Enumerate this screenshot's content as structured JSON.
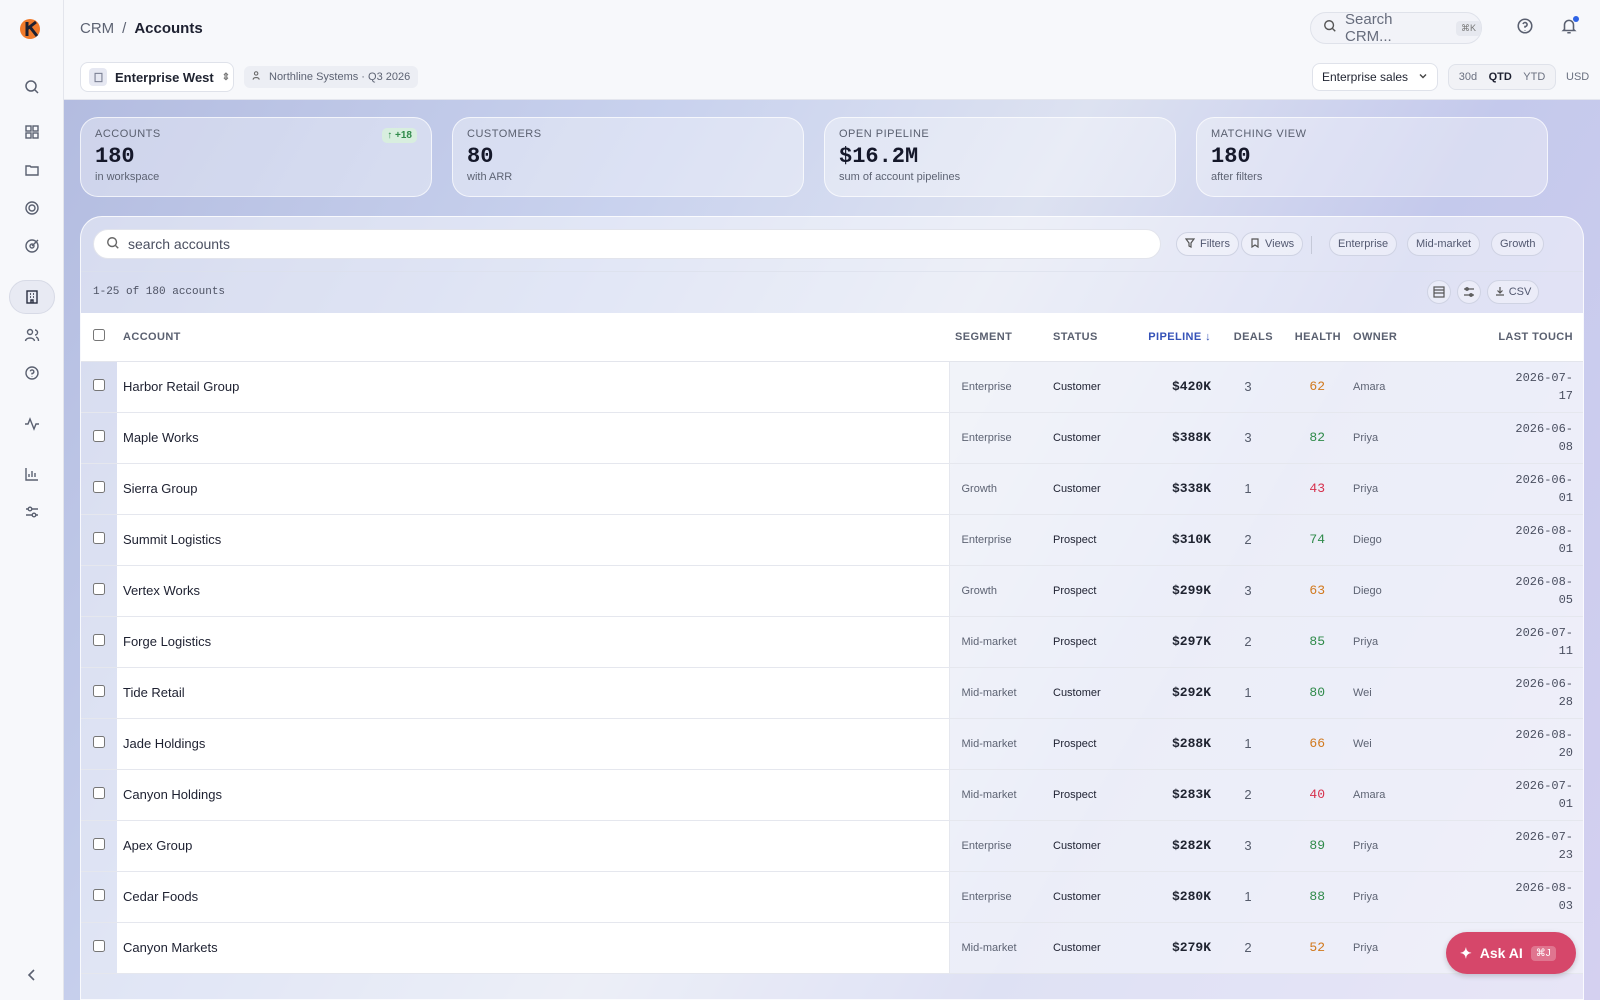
{
  "header": {
    "breadcrumb": [
      "CRM",
      "/",
      "Accounts"
    ],
    "search_placeholder": "Search CRM...",
    "search_shortcut": "⌘K"
  },
  "subbar": {
    "workspace": "Enterprise West",
    "org": "Northline Systems · Q3 2026",
    "team": "Enterprise sales",
    "periods": [
      "30d",
      "QTD",
      "YTD"
    ],
    "active_period": "QTD",
    "currency": "USD"
  },
  "stats": [
    {
      "label": "ACCOUNTS",
      "value": "180",
      "sub": "in workspace",
      "delta": "+18"
    },
    {
      "label": "CUSTOMERS",
      "value": "80",
      "sub": "with ARR"
    },
    {
      "label": "OPEN PIPELINE",
      "value": "$16.2M",
      "sub": "sum of account pipelines"
    },
    {
      "label": "MATCHING VIEW",
      "value": "180",
      "sub": "after filters"
    }
  ],
  "toolbar": {
    "search_placeholder": "search accounts",
    "filters_label": "Filters",
    "views_label": "Views",
    "segment_chips": [
      "Enterprise",
      "Mid-market",
      "Growth"
    ],
    "count_text": "1-25 of 180 accounts",
    "csv_label": "CSV"
  },
  "table": {
    "columns": [
      "ACCOUNT",
      "SEGMENT",
      "STATUS",
      "PIPELINE",
      "DEALS",
      "HEALTH",
      "OWNER",
      "LAST TOUCH"
    ],
    "rows": [
      {
        "account": "Harbor Retail Group",
        "segment": "Enterprise",
        "status": "Customer",
        "pipeline": "$420K",
        "deals": "3",
        "health": "62",
        "owner": "Amara",
        "last_touch": "2026-07-17"
      },
      {
        "account": "Maple Works",
        "segment": "Enterprise",
        "status": "Customer",
        "pipeline": "$388K",
        "deals": "3",
        "health": "82",
        "owner": "Priya",
        "last_touch": "2026-06-08"
      },
      {
        "account": "Sierra Group",
        "segment": "Growth",
        "status": "Customer",
        "pipeline": "$338K",
        "deals": "1",
        "health": "43",
        "owner": "Priya",
        "last_touch": "2026-06-01"
      },
      {
        "account": "Summit Logistics",
        "segment": "Enterprise",
        "status": "Prospect",
        "pipeline": "$310K",
        "deals": "2",
        "health": "74",
        "owner": "Diego",
        "last_touch": "2026-08-01"
      },
      {
        "account": "Vertex Works",
        "segment": "Growth",
        "status": "Prospect",
        "pipeline": "$299K",
        "deals": "3",
        "health": "63",
        "owner": "Diego",
        "last_touch": "2026-08-05"
      },
      {
        "account": "Forge Logistics",
        "segment": "Mid-market",
        "status": "Prospect",
        "pipeline": "$297K",
        "deals": "2",
        "health": "85",
        "owner": "Priya",
        "last_touch": "2026-07-11"
      },
      {
        "account": "Tide Retail",
        "segment": "Mid-market",
        "status": "Customer",
        "pipeline": "$292K",
        "deals": "1",
        "health": "80",
        "owner": "Wei",
        "last_touch": "2026-06-28"
      },
      {
        "account": "Jade Holdings",
        "segment": "Mid-market",
        "status": "Prospect",
        "pipeline": "$288K",
        "deals": "1",
        "health": "66",
        "owner": "Wei",
        "last_touch": "2026-08-20"
      },
      {
        "account": "Canyon Holdings",
        "segment": "Mid-market",
        "status": "Prospect",
        "pipeline": "$283K",
        "deals": "2",
        "health": "40",
        "owner": "Amara",
        "last_touch": "2026-07-01"
      },
      {
        "account": "Apex Group",
        "segment": "Enterprise",
        "status": "Customer",
        "pipeline": "$282K",
        "deals": "3",
        "health": "89",
        "owner": "Priya",
        "last_touch": "2026-07-23"
      },
      {
        "account": "Cedar Foods",
        "segment": "Enterprise",
        "status": "Customer",
        "pipeline": "$280K",
        "deals": "1",
        "health": "88",
        "owner": "Priya",
        "last_touch": "2026-08-03"
      },
      {
        "account": "Canyon Markets",
        "segment": "Mid-market",
        "status": "Customer",
        "pipeline": "$279K",
        "deals": "2",
        "health": "52",
        "owner": "Priya",
        "last_touch": ""
      }
    ]
  },
  "ask_ai": {
    "label": "Ask AI",
    "shortcut": "⌘J"
  },
  "colors": {
    "health_good": "#2f8a4a",
    "health_mid": "#d1781c",
    "health_bad": "#d6304c",
    "accent": "#3552b8",
    "ask_ai": "#d6476a"
  }
}
